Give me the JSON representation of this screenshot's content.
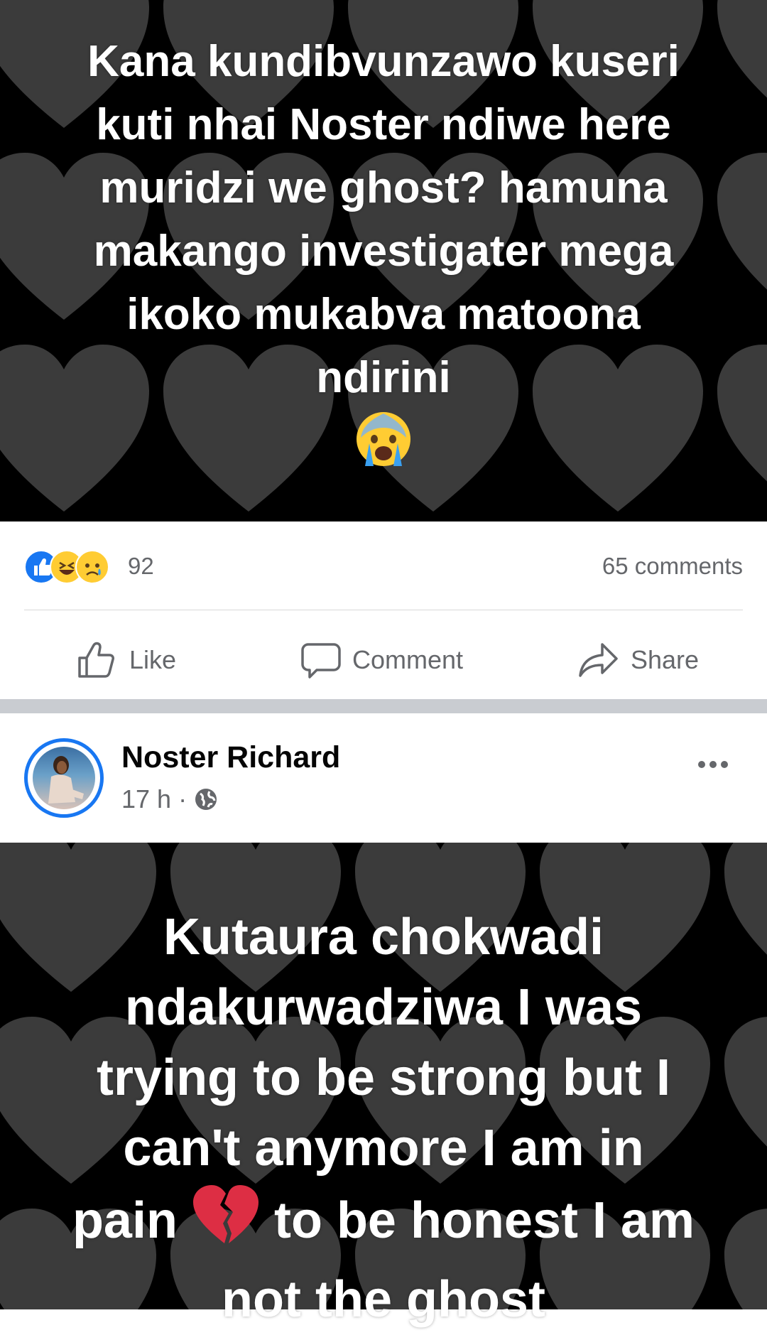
{
  "post1": {
    "text": "Kana kundibvunzawo kuseri kuti nhai Noster ndiwe here muridzi we ghost? hamuna makango investigater mega ikoko mukabva matoona ndirini",
    "emoji": "crying-face"
  },
  "stats": {
    "reactions": [
      "like",
      "haha",
      "sad"
    ],
    "reaction_count": "92",
    "comments": "65 comments"
  },
  "actions": {
    "like": "Like",
    "comment": "Comment",
    "share": "Share"
  },
  "post2": {
    "author": "Noster Richard",
    "time": "17 h",
    "separator": "·",
    "privacy_icon": "globe-icon",
    "text_before_emoji": "Kutaura chokwadi ndakurwadziwa I was trying to be strong but I can't anymore I am in pain",
    "emoji": "broken-heart",
    "text_after_emoji": "to be honest I am not the ghost"
  },
  "colors": {
    "background": "#000000",
    "heart": "#3a3a3a",
    "accent": "#1877f2",
    "muted": "#65676b"
  }
}
